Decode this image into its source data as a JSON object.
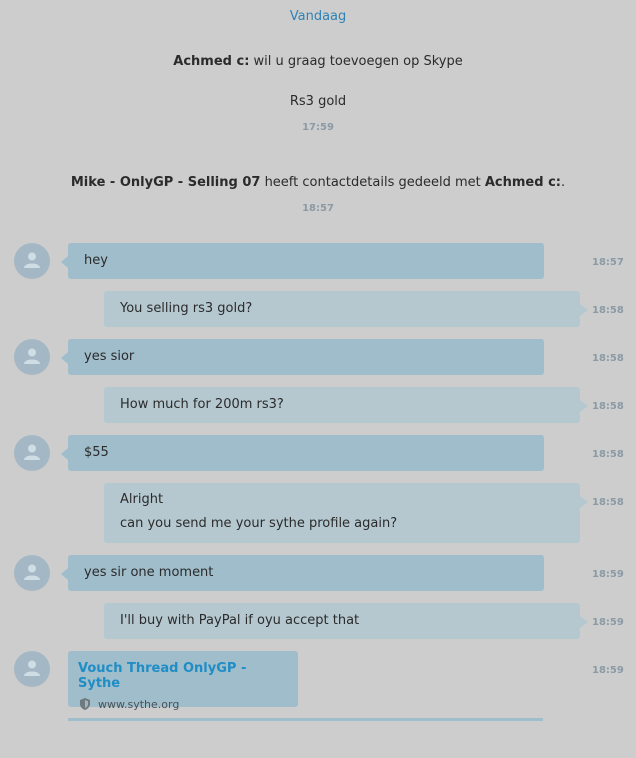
{
  "day_label": "Vandaag",
  "system": {
    "line1_name": "Achmed c:",
    "line1_text": " wil u graag toevoegen op Skype",
    "line2_text": "Rs3 gold",
    "time1": "17:59",
    "share_name1": "Mike - OnlyGP - Selling 07",
    "share_text": " heeft contactdetails gedeeld met ",
    "share_name2": "Achmed c:",
    "share_end": ".",
    "time2": "18:57"
  },
  "messages": [
    {
      "dir": "in",
      "text": "hey",
      "time": "18:57"
    },
    {
      "dir": "out",
      "text": "You selling rs3 gold?",
      "time": "18:58"
    },
    {
      "dir": "in",
      "text": "yes sior",
      "time": "18:58"
    },
    {
      "dir": "out",
      "text": "How much for 200m rs3?",
      "time": "18:58"
    },
    {
      "dir": "in",
      "text": "$55",
      "time": "18:58"
    },
    {
      "dir": "out",
      "text_line1": "Alright",
      "text_line2": "can you send me your sythe profile again?",
      "time": "18:58"
    },
    {
      "dir": "in",
      "text": "yes sir one moment",
      "time": "18:59"
    },
    {
      "dir": "out",
      "text": "I'll buy with PayPal if oyu accept that",
      "time": "18:59"
    }
  ],
  "link_preview": {
    "title": "Vouch Thread OnlyGP - Sythe",
    "url": "www.sythe.org",
    "time": "18:59",
    "icon": "shield-icon"
  },
  "colors": {
    "background": "#cdcdcd",
    "incoming_bubble": "#9fbdcb",
    "outgoing_bubble": "#b5c8d0",
    "link": "#1f8dc6",
    "accent": "#2e83b6"
  }
}
